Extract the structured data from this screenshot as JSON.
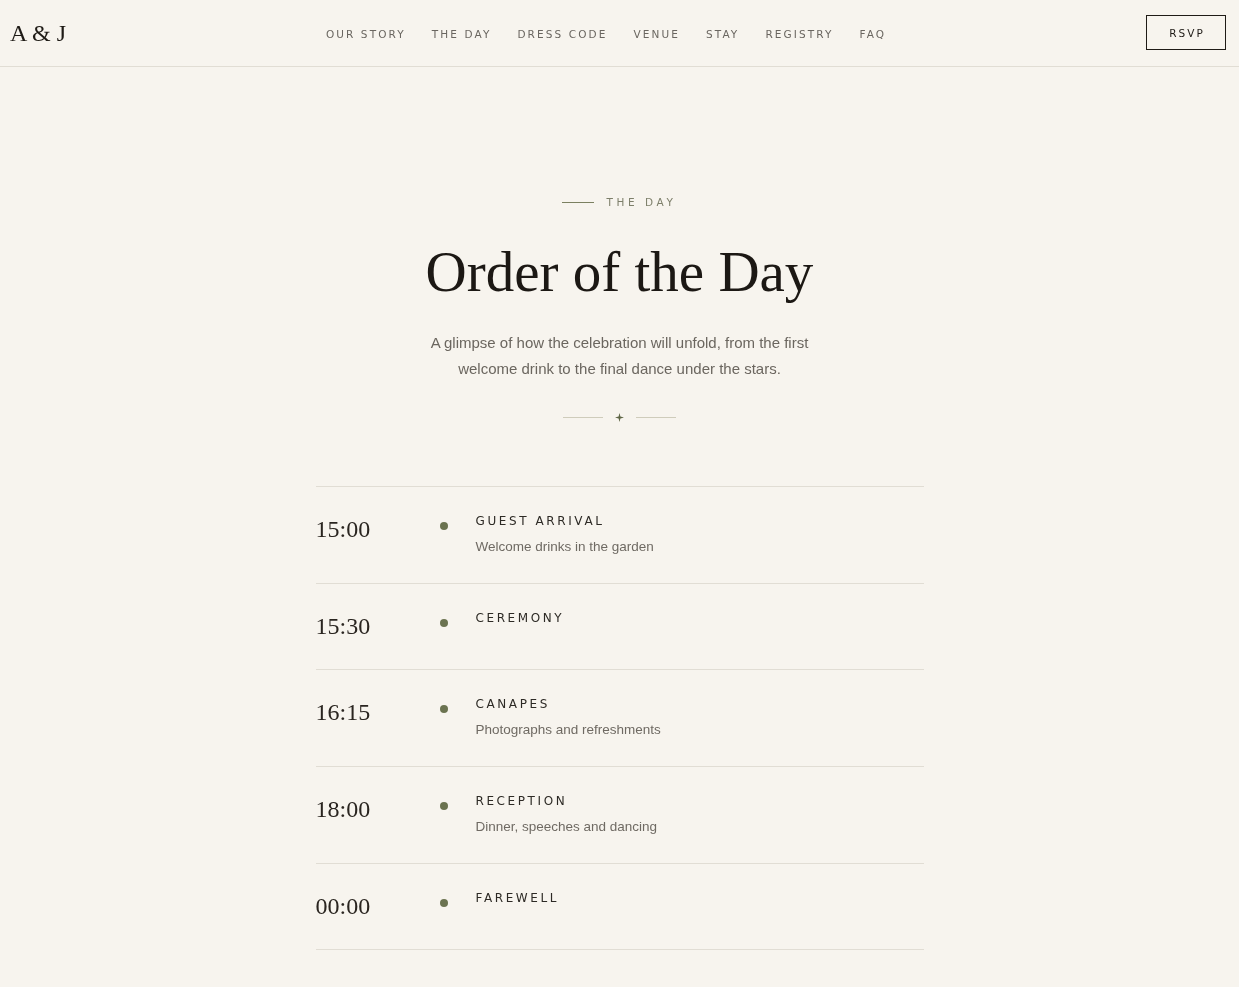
{
  "header": {
    "logo": "A & J",
    "nav": [
      {
        "label": "OUR STORY"
      },
      {
        "label": "THE DAY"
      },
      {
        "label": "DRESS CODE"
      },
      {
        "label": "VENUE"
      },
      {
        "label": "STAY"
      },
      {
        "label": "REGISTRY"
      },
      {
        "label": "FAQ"
      }
    ],
    "rsvp": "RSVP"
  },
  "section": {
    "eyebrow": "THE DAY",
    "title": "Order of the Day",
    "description": "A glimpse of how the celebration will unfold, from the first welcome drink to the final dance under the stars.",
    "schedule": [
      {
        "time": "15:00",
        "title": "GUEST ARRIVAL",
        "description": "Welcome drinks in the garden"
      },
      {
        "time": "15:30",
        "title": "CEREMONY"
      },
      {
        "time": "16:15",
        "title": "CANAPES",
        "description": "Photographs and refreshments"
      },
      {
        "time": "18:00",
        "title": "RECEPTION",
        "description": "Dinner, speeches and dancing"
      },
      {
        "time": "00:00",
        "title": "FAREWELL"
      }
    ]
  }
}
